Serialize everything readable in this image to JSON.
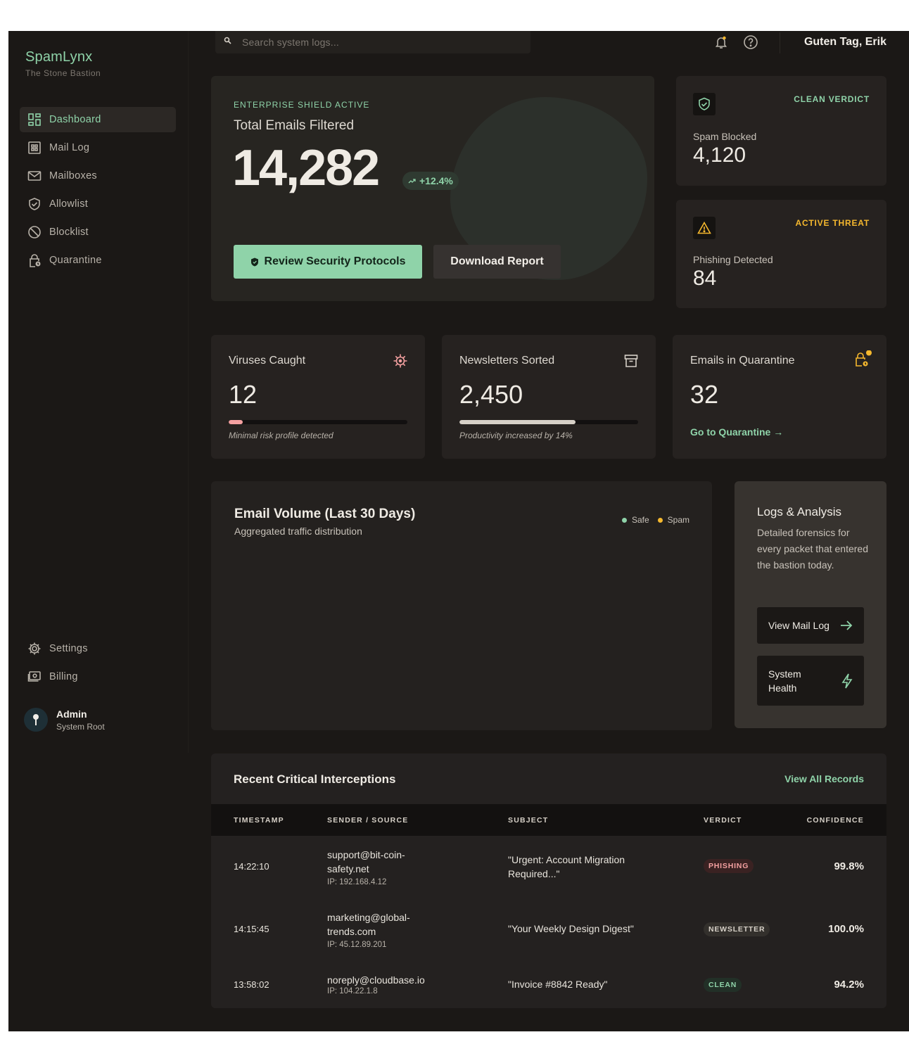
{
  "brand": {
    "name": "SpamLynx",
    "subtitle": "The Stone Bastion"
  },
  "sidebar": {
    "items": [
      {
        "label": "Dashboard",
        "icon": "dashboard-icon",
        "active": true
      },
      {
        "label": "Mail Log",
        "icon": "grid-icon"
      },
      {
        "label": "Mailboxes",
        "icon": "envelope-icon"
      },
      {
        "label": "Allowlist",
        "icon": "shield-check-icon"
      },
      {
        "label": "Blocklist",
        "icon": "block-icon"
      },
      {
        "label": "Quarantine",
        "icon": "lock-clock-icon"
      }
    ],
    "bottom_items": [
      {
        "label": "Settings",
        "icon": "gear-icon"
      },
      {
        "label": "Billing",
        "icon": "billing-icon"
      }
    ],
    "user": {
      "name": "Admin",
      "role": "System Root"
    }
  },
  "header": {
    "search_placeholder": "Search system logs...",
    "greeting": "Guten Tag, Erik"
  },
  "hero": {
    "eyebrow": "ENTERPRISE SHIELD ACTIVE",
    "title": "Total Emails Filtered",
    "value": "14,282",
    "delta": "+12.4%",
    "primary_button": "Review Security Protocols",
    "secondary_button": "Download Report"
  },
  "spam_card": {
    "tag": "CLEAN VERDICT",
    "label": "Spam Blocked",
    "value": "4,120",
    "tag_color": "#8fd3a9"
  },
  "phish_card": {
    "tag": "ACTIVE THREAT",
    "label": "Phishing Detected",
    "value": "84",
    "tag_color": "#f5b82e"
  },
  "stats": {
    "viruses": {
      "title": "Viruses Caught",
      "value": "12",
      "note": "Minimal risk profile detected",
      "progress": 0.08
    },
    "newsletters": {
      "title": "Newsletters Sorted",
      "value": "2,450",
      "note": "Productivity increased by 14%",
      "progress": 0.65
    },
    "quarantine": {
      "title": "Emails in Quarantine",
      "value": "32",
      "link": "Go to Quarantine →"
    }
  },
  "chart": {
    "title": "Email Volume (Last 30 Days)",
    "subtitle": "Aggregated traffic distribution",
    "legend": [
      {
        "name": "Safe",
        "color": "#8fd3a9"
      },
      {
        "name": "Spam",
        "color": "#f5b82e"
      }
    ]
  },
  "logs": {
    "title": "Logs & Analysis",
    "text": "Detailed forensics for every packet that entered the bastion today.",
    "btn_mail_log": "View Mail Log",
    "btn_health": "System Health"
  },
  "table": {
    "title": "Recent Critical Interceptions",
    "view_all": "View All Records",
    "headers": {
      "timestamp": "TIMESTAMP",
      "sender": "SENDER / SOURCE",
      "subject": "SUBJECT",
      "verdict": "VERDICT",
      "confidence": "CONFIDENCE"
    },
    "rows": [
      {
        "time": "14:22:10",
        "sender": "support@bit-coin-safety.net",
        "ip": "IP: 192.168.4.12",
        "subject": "\"Urgent: Account Migration Required...\"",
        "verdict": "PHISHING",
        "confidence": "99.8%"
      },
      {
        "time": "14:15:45",
        "sender": "marketing@global-trends.com",
        "ip": "IP: 45.12.89.201",
        "subject": "\"Your Weekly Design Digest\"",
        "verdict": "NEWSLETTER",
        "confidence": "100.0%"
      },
      {
        "time": "13:58:02",
        "sender": "noreply@cloudbase.io",
        "ip": "IP: 104.22.1.8",
        "subject": "\"Invoice #8842 Ready\"",
        "verdict": "CLEAN",
        "confidence": "94.2%"
      }
    ]
  },
  "colors": {
    "accent": "#8fd3a9",
    "warning": "#f5b82e",
    "danger": "#f4a0a0",
    "background": "#1b1816"
  }
}
